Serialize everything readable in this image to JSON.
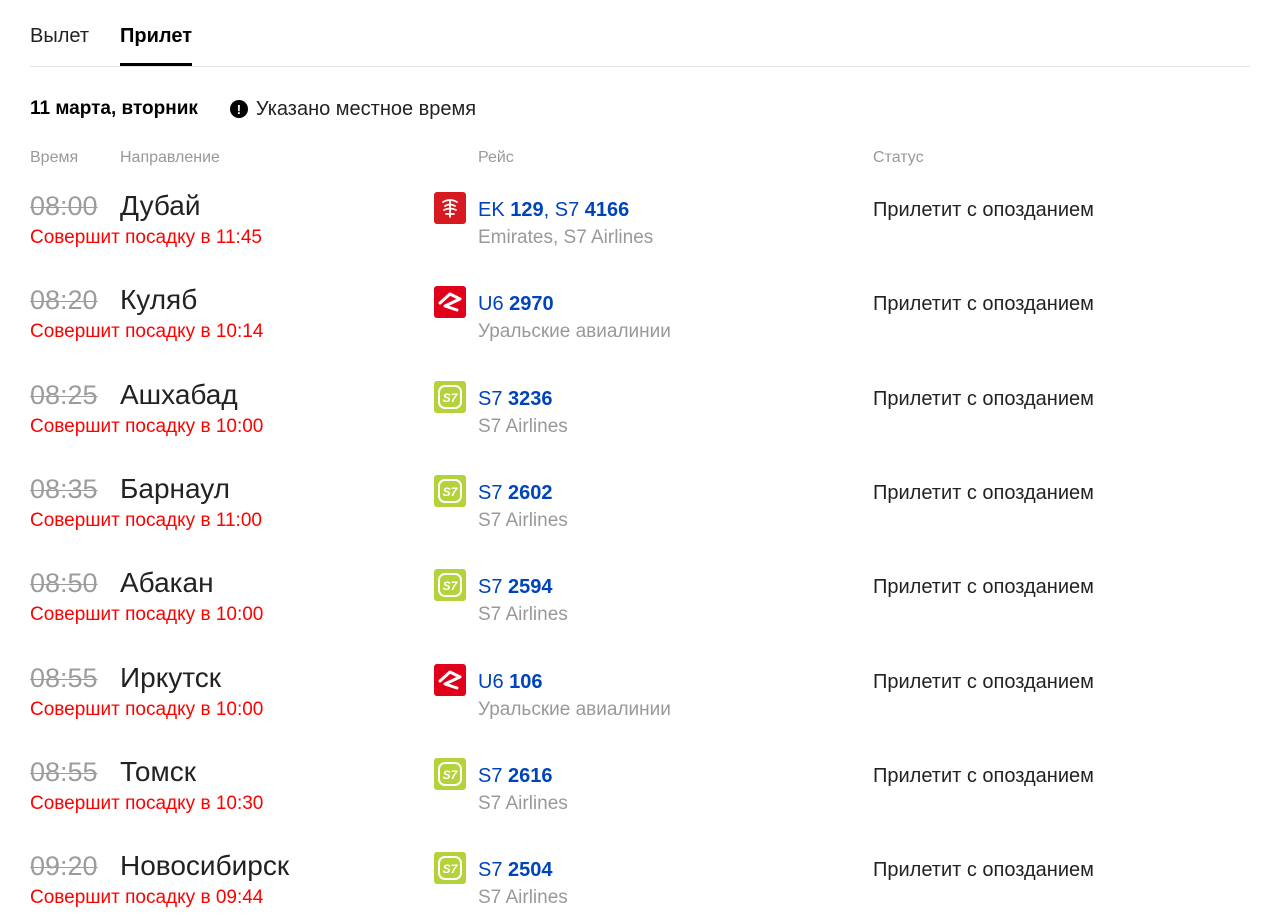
{
  "tabs": [
    {
      "label": "Вылет",
      "active": false
    },
    {
      "label": "Прилет",
      "active": true
    }
  ],
  "date_label": "11 марта, вторник",
  "notice": "Указано местное время",
  "columns": {
    "time": "Время",
    "direction": "Направление",
    "flight": "Рейс",
    "status": "Статус"
  },
  "flights": [
    {
      "time": "08:00",
      "city": "Дубай",
      "delay": "Совершит посадку в 11:45",
      "logo": "emirates-logo",
      "codes": [
        {
          "carrier": "EK",
          "number": "129"
        },
        {
          "carrier": "S7",
          "number": "4166"
        }
      ],
      "airline": "Emirates, S7 Airlines",
      "status": "Прилетит с опозданием"
    },
    {
      "time": "08:20",
      "city": "Куляб",
      "delay": "Совершит посадку в 10:14",
      "logo": "ural-airlines-logo",
      "codes": [
        {
          "carrier": "U6",
          "number": "2970"
        }
      ],
      "airline": "Уральские авиалинии",
      "status": "Прилетит с опозданием"
    },
    {
      "time": "08:25",
      "city": "Ашхабад",
      "delay": "Совершит посадку в 10:00",
      "logo": "s7-logo",
      "codes": [
        {
          "carrier": "S7",
          "number": "3236"
        }
      ],
      "airline": "S7 Airlines",
      "status": "Прилетит с опозданием"
    },
    {
      "time": "08:35",
      "city": "Барнаул",
      "delay": "Совершит посадку в 11:00",
      "logo": "s7-logo",
      "codes": [
        {
          "carrier": "S7",
          "number": "2602"
        }
      ],
      "airline": "S7 Airlines",
      "status": "Прилетит с опозданием"
    },
    {
      "time": "08:50",
      "city": "Абакан",
      "delay": "Совершит посадку в 10:00",
      "logo": "s7-logo",
      "codes": [
        {
          "carrier": "S7",
          "number": "2594"
        }
      ],
      "airline": "S7 Airlines",
      "status": "Прилетит с опозданием"
    },
    {
      "time": "08:55",
      "city": "Иркутск",
      "delay": "Совершит посадку в 10:00",
      "logo": "ural-airlines-logo",
      "codes": [
        {
          "carrier": "U6",
          "number": "106"
        }
      ],
      "airline": "Уральские авиалинии",
      "status": "Прилетит с опозданием"
    },
    {
      "time": "08:55",
      "city": "Томск",
      "delay": "Совершит посадку в 10:30",
      "logo": "s7-logo",
      "codes": [
        {
          "carrier": "S7",
          "number": "2616"
        }
      ],
      "airline": "S7 Airlines",
      "status": "Прилетит с опозданием"
    },
    {
      "time": "09:20",
      "city": "Новосибирск",
      "delay": "Совершит посадку в 09:44",
      "logo": "s7-logo",
      "codes": [
        {
          "carrier": "S7",
          "number": "2504"
        }
      ],
      "airline": "S7 Airlines",
      "status": "Прилетит с опозданием"
    }
  ],
  "colors": {
    "link": "#0044bb",
    "delay": "#ff0000",
    "muted": "#999999",
    "emirates": "#d71921",
    "ural": "#e1001a",
    "s7": "#b4d23a"
  }
}
